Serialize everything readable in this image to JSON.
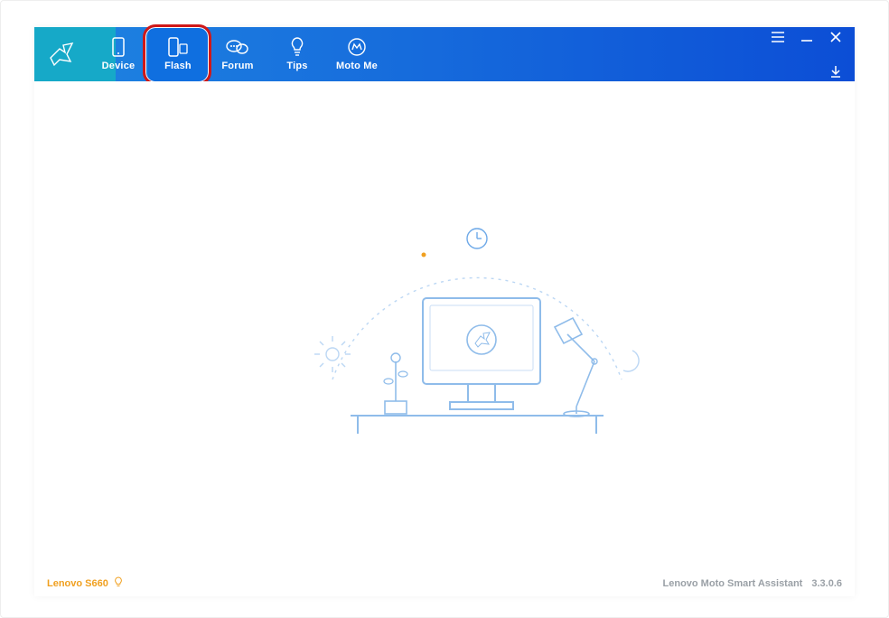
{
  "colors": {
    "teal": "#16a9c8",
    "blue": "#0c4ed6",
    "highlight": "#d01818",
    "accent": "#f0a020"
  },
  "nav": {
    "items": [
      {
        "label": "Device",
        "icon": "phone-icon"
      },
      {
        "label": "Flash",
        "icon": "phone-sd-icon"
      },
      {
        "label": "Forum",
        "icon": "bubbles-icon"
      },
      {
        "label": "Tips",
        "icon": "bulb-icon"
      },
      {
        "label": "Moto Me",
        "icon": "mo-icon"
      }
    ],
    "active_index": 1
  },
  "titlebar": {
    "menu_icon": "menu-icon",
    "minimize_icon": "minimize-icon",
    "close_icon": "close-icon",
    "download_icon": "download-icon"
  },
  "status": {
    "device_name": "Lenovo S660",
    "bulb_icon": "bulb-outline-icon",
    "app_name": "Lenovo Moto Smart Assistant",
    "app_version": "3.3.0.6"
  },
  "illustration": {
    "name": "desk-clock-monitor-lamp-plant-sun-moon"
  }
}
